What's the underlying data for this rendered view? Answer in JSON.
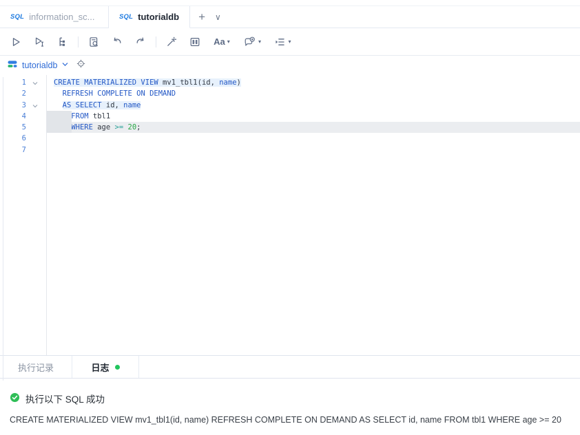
{
  "tabbar": {
    "icon_label": "SQL",
    "tabs": [
      {
        "label": "information_sc...",
        "active": false
      },
      {
        "label": "tutorialdb",
        "active": true
      }
    ],
    "new_tab_glyph": "+",
    "more_glyph": "∨"
  },
  "toolbar": {
    "case_label": "Aa"
  },
  "editor_header": {
    "connection": "tutorialdb"
  },
  "editor": {
    "lines": [
      {
        "num": 1,
        "fold": true,
        "hlFrom": 0,
        "segments": [
          {
            "t": "CREATE MATERIALIZED VIEW ",
            "c": "kw"
          },
          {
            "t": "mv1_tbl1(id, ",
            "c": "pl"
          },
          {
            "t": "name",
            "c": "kw"
          },
          {
            "t": ")",
            "c": "pl"
          }
        ]
      },
      {
        "num": 2,
        "segments": [
          {
            "t": "  ",
            "c": "pl"
          },
          {
            "t": "REFRESH COMPLETE ON DEMAND",
            "c": "kw"
          }
        ]
      },
      {
        "num": 3,
        "fold": true,
        "hlFrom": 1,
        "segments": [
          {
            "t": "  ",
            "c": "pl"
          },
          {
            "t": "AS SELECT ",
            "c": "kw"
          },
          {
            "t": "id, ",
            "c": "pl"
          },
          {
            "t": "name",
            "c": "kw"
          }
        ]
      },
      {
        "num": 4,
        "indent": true,
        "segments": [
          {
            "t": "    ",
            "c": "pl"
          },
          {
            "t": "FROM",
            "c": "kw"
          },
          {
            "t": " tbl1",
            "c": "pl"
          }
        ]
      },
      {
        "num": 5,
        "indent": true,
        "cur": true,
        "segments": [
          {
            "t": "    ",
            "c": "pl"
          },
          {
            "t": "WHERE",
            "c": "kw"
          },
          {
            "t": " age ",
            "c": "pl"
          },
          {
            "t": ">=",
            "c": "op"
          },
          {
            "t": " ",
            "c": "pl"
          },
          {
            "t": "20",
            "c": "num"
          },
          {
            "t": ";",
            "c": "pl"
          }
        ]
      },
      {
        "num": 6,
        "segments": []
      },
      {
        "num": 7,
        "segments": []
      }
    ]
  },
  "bottom_tabs": {
    "records": "执行记录",
    "log": "日志"
  },
  "log": {
    "status": "执行以下 SQL 成功",
    "sql": "CREATE MATERIALIZED VIEW mv1_tbl1(id, name) REFRESH COMPLETE ON DEMAND AS SELECT id, name FROM tbl1 WHERE age >= 20"
  },
  "colors": {
    "accent_blue": "#2e6bd6",
    "keyword": "#2257c5",
    "operator": "#2aa198",
    "number": "#28a745",
    "success_green": "#22c55e",
    "current_line": "#ebedf0",
    "statement_highlight": "#e7f1fc"
  }
}
